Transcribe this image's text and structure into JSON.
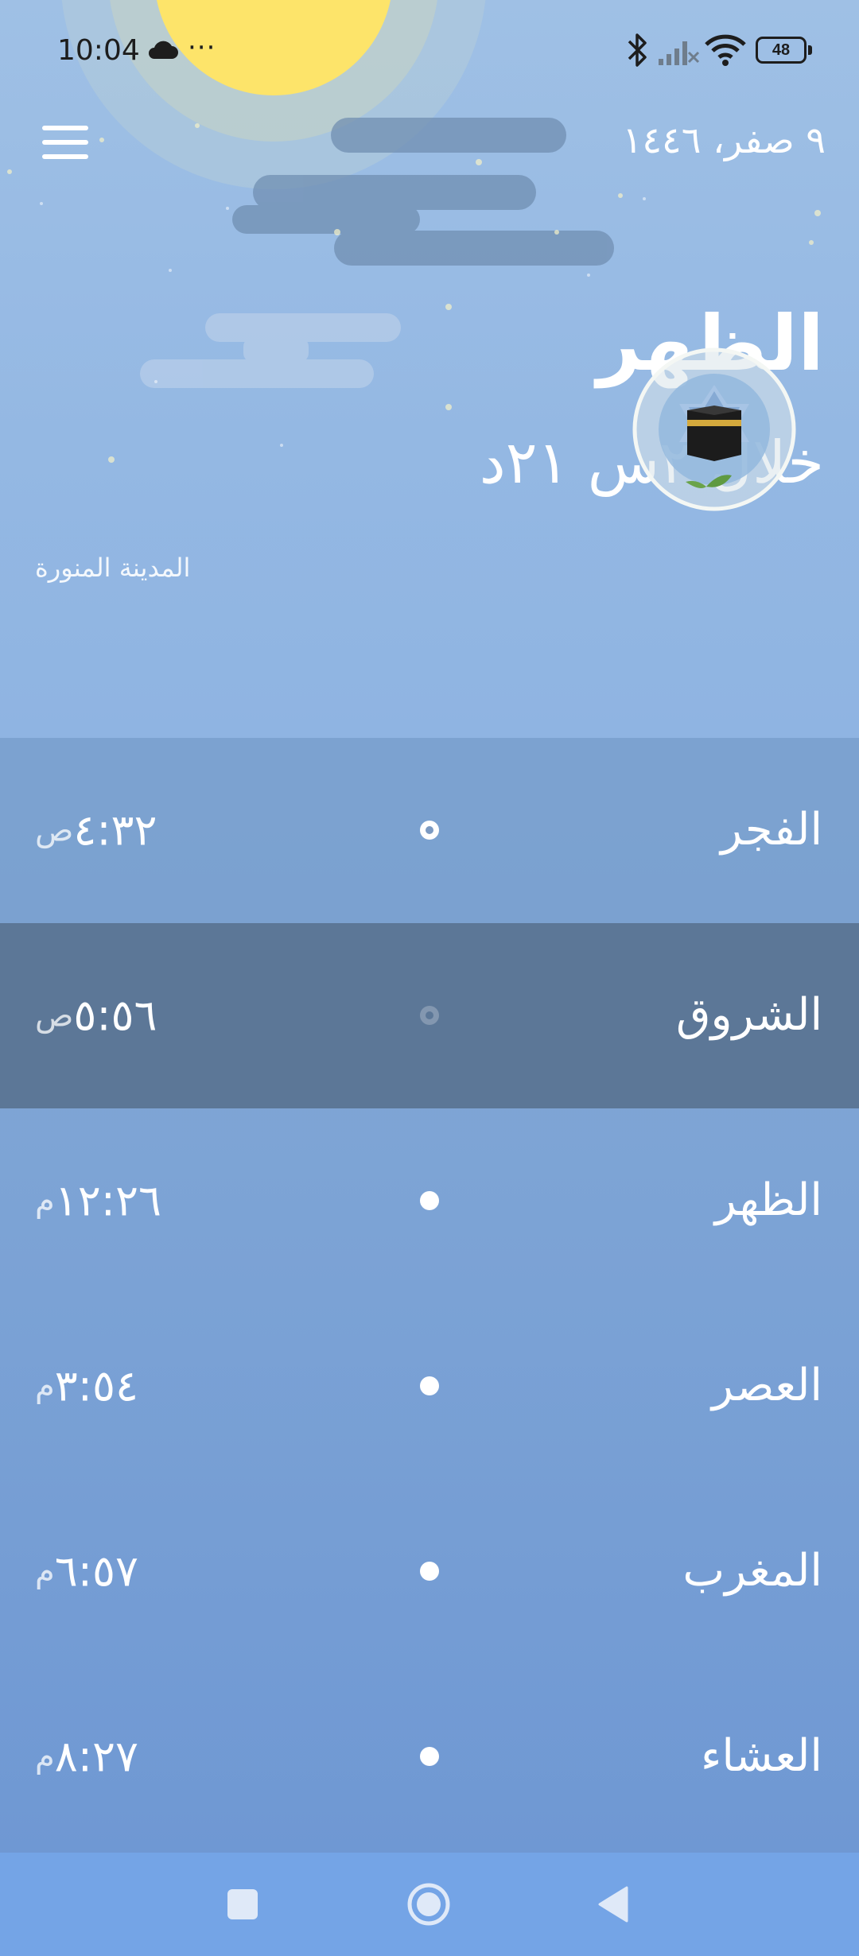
{
  "status_bar": {
    "time": "10:04",
    "overflow_dots": "···",
    "battery_level": "48",
    "icons": [
      "cloud-icon",
      "bluetooth-icon",
      "cellular-signal-icon",
      "wifi-icon",
      "battery-icon"
    ]
  },
  "header": {
    "hijri_date": "٩ صفر، ١٤٤٦",
    "menu_icon": "menu-icon"
  },
  "hero": {
    "next_prayer_name": "الظهر",
    "countdown": "خلال ٢س ٢١د",
    "city": "المدينة المنورة",
    "qibla_icon": "kaaba-icon"
  },
  "prayers": [
    {
      "name": "الفجر",
      "time": "٤:٣٢",
      "period": "ص",
      "active": false
    },
    {
      "name": "الشروق",
      "time": "٥:٥٦",
      "period": "ص",
      "active": true
    },
    {
      "name": "الظهر",
      "time": "١٢:٢٦",
      "period": "م",
      "active": false
    },
    {
      "name": "العصر",
      "time": "٣:٥٤",
      "period": "م",
      "active": false
    },
    {
      "name": "المغرب",
      "time": "٦:٥٧",
      "period": "م",
      "active": false
    },
    {
      "name": "العشاء",
      "time": "٨:٢٧",
      "period": "م",
      "active": false
    }
  ],
  "nav_bar": {
    "icons": [
      "recents-square-icon",
      "home-circle-icon",
      "back-triangle-icon"
    ]
  },
  "colors": {
    "sky": "#9fc0e5",
    "active_row": "#5c7797",
    "list_bg": "#7ba2d5",
    "nav_bar": "#74a4e6",
    "sun": "#fde46a"
  }
}
